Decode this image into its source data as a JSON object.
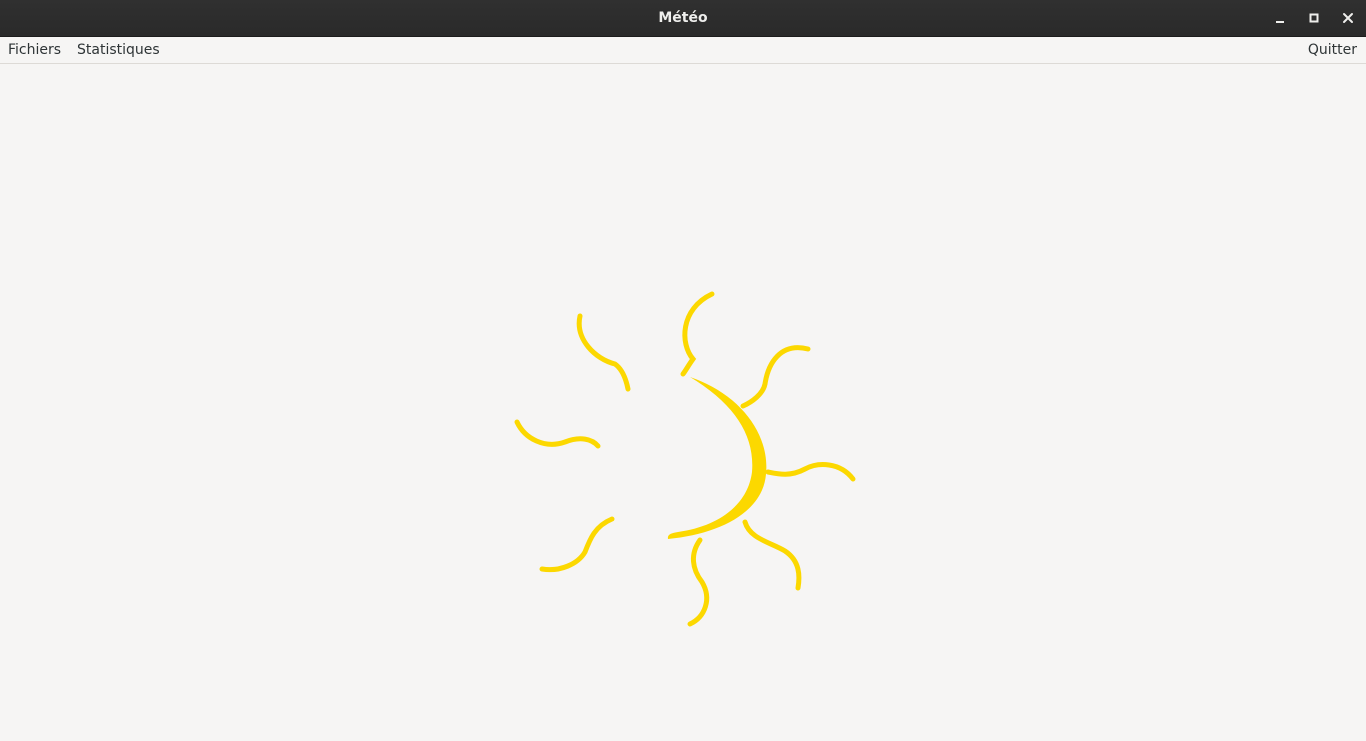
{
  "window": {
    "title": "Météo",
    "controls": {
      "minimize_icon": "minimize-icon",
      "maximize_icon": "maximize-icon",
      "close_icon": "close-icon"
    }
  },
  "menubar": {
    "items": [
      {
        "label": "Fichiers"
      },
      {
        "label": "Statistiques"
      }
    ],
    "quit_label": "Quitter"
  },
  "content": {
    "loading_icon": "sun-spinner-icon",
    "accent_color": "#fcd800",
    "background_color": "#f6f5f4"
  }
}
